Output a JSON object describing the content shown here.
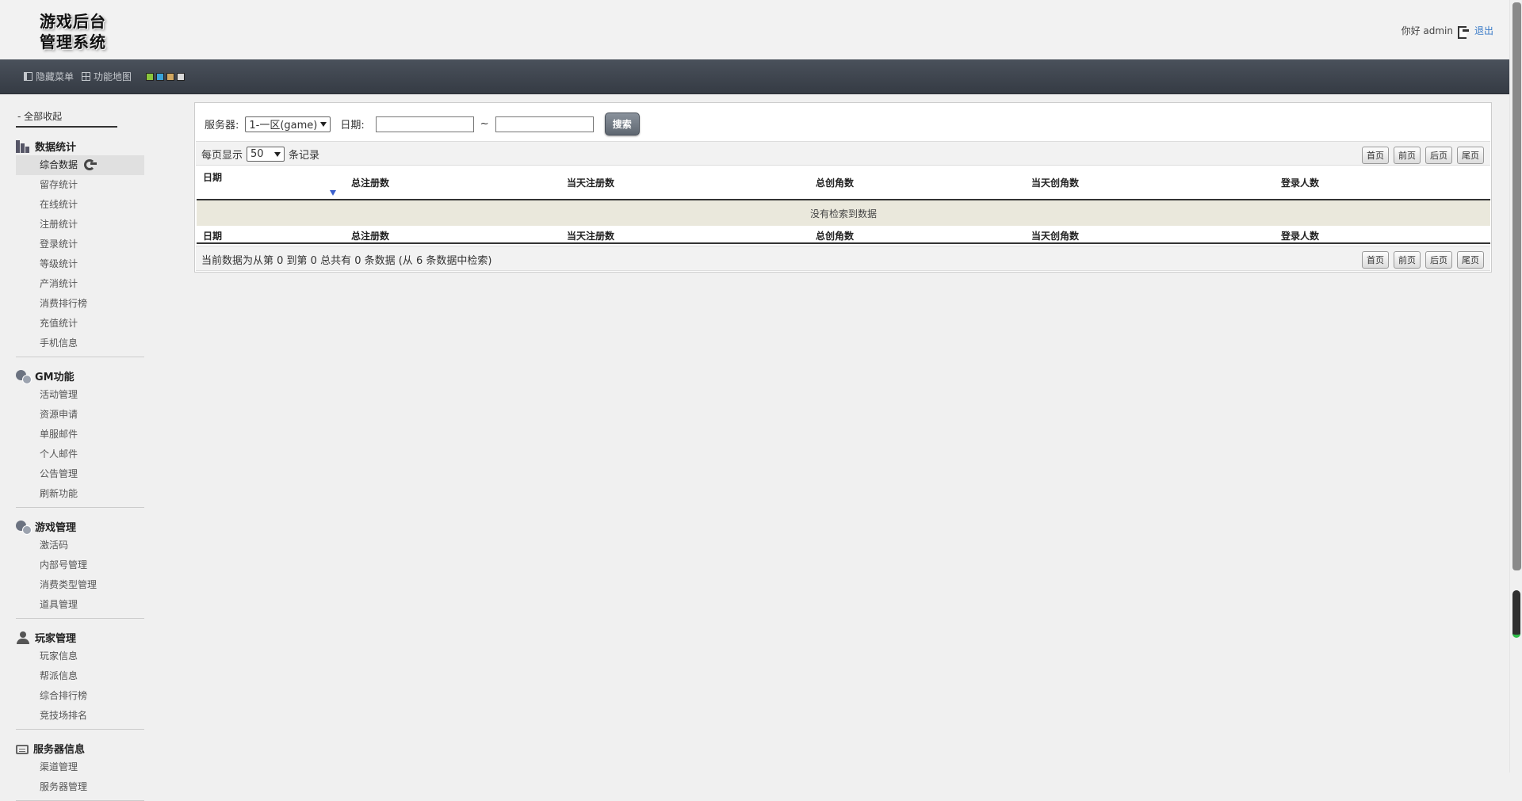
{
  "header": {
    "logo_line1": "游戏后台",
    "logo_line2": "管理系统",
    "greeting": "你好 admin",
    "logout": "退出"
  },
  "toolbar": {
    "hide_menu": "隐藏菜单",
    "function_map": "功能地图",
    "swatches": [
      "#8ac53c",
      "#3aa3d9",
      "#d1a760",
      "#d9d9d9"
    ]
  },
  "sidebar": {
    "collapse_all": "- 全部收起",
    "groups": [
      {
        "title": "数据统计",
        "icon": "bar-chart-icon",
        "items": [
          "综合数据",
          "留存统计",
          "在线统计",
          "注册统计",
          "登录统计",
          "等级统计",
          "产消统计",
          "消费排行榜",
          "充值统计",
          "手机信息"
        ]
      },
      {
        "title": "GM功能",
        "icon": "chat-bubbles-icon",
        "items": [
          "活动管理",
          "资源申请",
          "单服邮件",
          "个人邮件",
          "公告管理",
          "刷新功能"
        ]
      },
      {
        "title": "游戏管理",
        "icon": "chat-bubbles-icon",
        "items": [
          "激活码",
          "内部号管理",
          "消费类型管理",
          "道具管理"
        ]
      },
      {
        "title": "玩家管理",
        "icon": "user-icon",
        "items": [
          "玩家信息",
          "帮派信息",
          "综合排行榜",
          "竞技场排名"
        ]
      },
      {
        "title": "服务器信息",
        "icon": "server-icon",
        "items": [
          "渠道管理",
          "服务器管理"
        ]
      }
    ]
  },
  "filter": {
    "server_label": "服务器:",
    "server_value": "1-一区(game)",
    "date_label": "日期:",
    "tilde": "~",
    "search_button": "搜索"
  },
  "table": {
    "page_size_prefix": "每页显示",
    "page_size_value": "50",
    "page_size_suffix": "条记录",
    "pager": [
      "首页",
      "前页",
      "后页",
      "尾页"
    ],
    "columns": [
      "日期",
      "总注册数",
      "当天注册数",
      "总创角数",
      "当天创角数",
      "登录人数"
    ],
    "empty_message": "没有检索到数据",
    "info": "当前数据为从第 0 到第 0 总共有 0 条数据 (从 6 条数据中检索)"
  }
}
